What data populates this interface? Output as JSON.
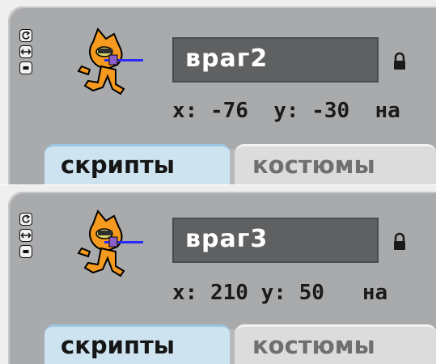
{
  "sprites": [
    {
      "name": "враг2",
      "x_label": "x:",
      "x_value": "-76",
      "y_label": "y:",
      "y_value": "-30",
      "direction_label_partial": "на",
      "tabs": [
        {
          "label": "скрипты",
          "active": true
        },
        {
          "label": "костюмы",
          "active": false
        }
      ]
    },
    {
      "name": "враг3",
      "x_label": "x:",
      "x_value": "210",
      "y_label": "y:",
      "y_value": "50",
      "direction_label_partial": "на",
      "tabs": [
        {
          "label": "скрипты",
          "active": true
        },
        {
          "label": "костюмы",
          "active": false
        }
      ]
    }
  ],
  "icons": {
    "rotation_buttons": [
      "rotate-all-around-icon",
      "left-right-flip-icon",
      "dont-rotate-icon"
    ],
    "lock": "lock-icon",
    "sprite": "cat-sprite-thumbnail"
  },
  "colors": {
    "panel": "#a9aaac",
    "name_box": "#5f6062",
    "active_tab": "#cde3f0",
    "inactive_tab": "#dcdcdd"
  }
}
